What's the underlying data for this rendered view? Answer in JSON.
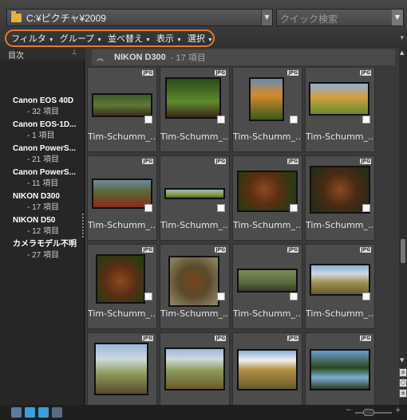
{
  "toolbar": {
    "path": "C:¥ピクチャ¥2009",
    "search_placeholder": "クイック検索",
    "menu": [
      {
        "label": "フィルタ"
      },
      {
        "label": "グループ"
      },
      {
        "label": "並べ替え"
      },
      {
        "label": "表示"
      },
      {
        "label": "選択"
      }
    ]
  },
  "sidebar": {
    "title": "目次",
    "pin": "ᵖ",
    "items": [
      {
        "name": "Canon EOS 40D",
        "count": "- 32 項目"
      },
      {
        "name": "Canon EOS-1D...",
        "count": "- 1 項目"
      },
      {
        "name": "Canon PowerS...",
        "count": "- 21 項目"
      },
      {
        "name": "Canon PowerS...",
        "count": "- 11 項目"
      },
      {
        "name": "NIKON D300",
        "count": "- 17 項目"
      },
      {
        "name": "NIKON D50",
        "count": "- 12 項目"
      },
      {
        "name": "カメラモデル不明",
        "count": "- 27 項目"
      }
    ]
  },
  "group": {
    "name": "NIKON D300",
    "count": "- 17 項目"
  },
  "thumbs": [
    {
      "label": "Tim-Schumm_..."
    },
    {
      "label": "Tim-Schumm_..."
    },
    {
      "label": "Tim-Schumm_..."
    },
    {
      "label": "Tim-Schumm_..."
    },
    {
      "label": "Tim-Schumm_..."
    },
    {
      "label": "Tim-Schumm_..."
    },
    {
      "label": "Tim-Schumm_..."
    },
    {
      "label": "Tim-Schumm_..."
    },
    {
      "label": "Tim-Schumm_..."
    },
    {
      "label": "Tim-Schumm_..."
    },
    {
      "label": "Tim-Schumm_..."
    },
    {
      "label": "Tim-Schumm_..."
    },
    {
      "label": ""
    },
    {
      "label": ""
    },
    {
      "label": ""
    },
    {
      "label": ""
    }
  ],
  "badge": "JPG",
  "colors": {
    "accent": "#e5782a",
    "folder": "#e3b23c"
  }
}
